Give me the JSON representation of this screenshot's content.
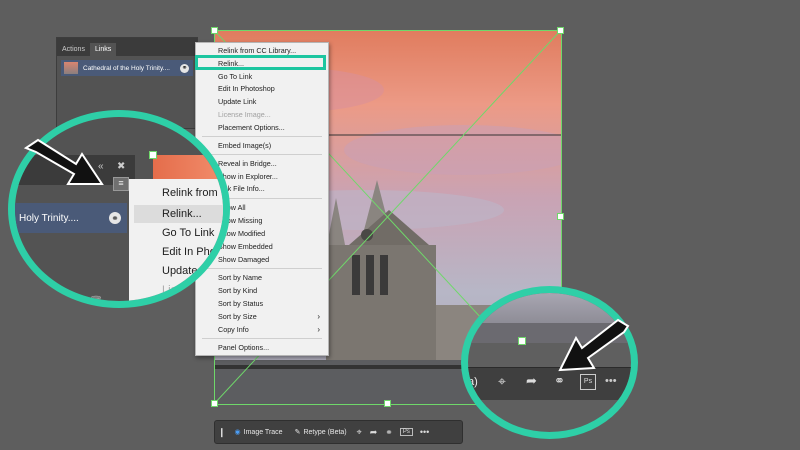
{
  "links_panel": {
    "tabs": [
      "Actions",
      "Links"
    ],
    "active_tab": "Links",
    "link_name": "Cathedral of the Holy Trinity...."
  },
  "menu": {
    "items": [
      {
        "label": "Relink from CC Library...",
        "disabled": false
      },
      {
        "label": "Relink...",
        "disabled": false,
        "highlighted": true
      },
      {
        "label": "Go To Link",
        "disabled": false
      },
      {
        "label": "Edit In Photoshop",
        "disabled": false
      },
      {
        "label": "Update Link",
        "disabled": false
      },
      {
        "label": "License Image...",
        "disabled": true
      },
      {
        "label": "Placement Options...",
        "disabled": false
      },
      {
        "label": "Embed Image(s)",
        "disabled": false
      },
      {
        "label": "Reveal in Bridge...",
        "disabled": false
      },
      {
        "label": "Show in Explorer...",
        "disabled": false
      },
      {
        "label": "Link File Info...",
        "disabled": false
      },
      {
        "label": "Show All",
        "disabled": false
      },
      {
        "label": "Show Missing",
        "disabled": false
      },
      {
        "label": "Show Modified",
        "disabled": false
      },
      {
        "label": "Show Embedded",
        "disabled": false
      },
      {
        "label": "Show Damaged",
        "disabled": false
      },
      {
        "label": "Sort by Name",
        "disabled": false
      },
      {
        "label": "Sort by Kind",
        "disabled": false
      },
      {
        "label": "Sort by Status",
        "disabled": false
      },
      {
        "label": "Sort by Size",
        "disabled": false,
        "submenu": true
      },
      {
        "label": "Copy Info",
        "disabled": false,
        "submenu": true
      },
      {
        "label": "Panel Options...",
        "disabled": false
      }
    ]
  },
  "zoom_left": {
    "link_name": "Holy Trinity....",
    "menu_items": [
      "Relink from",
      "Relink...",
      "Go To Link",
      "Edit In Pho",
      "Update L",
      "Lic"
    ]
  },
  "zoom_right": {
    "partial_label": "a)"
  },
  "toolbar": {
    "image_trace": "Image Trace",
    "retype": "Retype (Beta)",
    "more": "•••"
  },
  "colors": {
    "accent": "#2ecfa7",
    "selection": "#6fd86a",
    "panel": "#535353",
    "menu_bg": "#f1f1f1"
  }
}
